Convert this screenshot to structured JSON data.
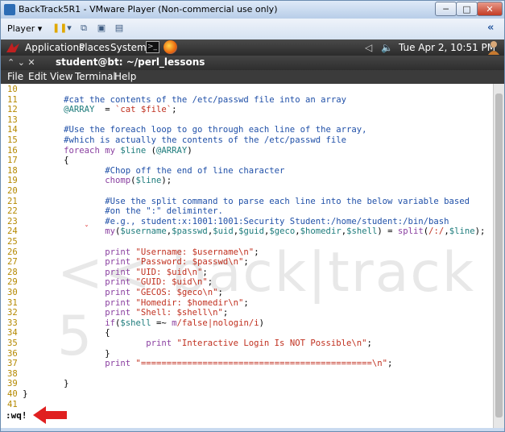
{
  "window": {
    "title": "BackTrack5R1 - VMware Player (Non-commercial use only)",
    "min_glyph": "─",
    "max_glyph": "□",
    "close_glyph": "✕"
  },
  "vmtoolbar": {
    "player_label": "Player ▾",
    "collapse_glyph": "«"
  },
  "gnome_panel": {
    "applications": "Applications",
    "places": "Places",
    "system": "System",
    "datetime": "Tue Apr  2, 10:51 PM"
  },
  "terminal": {
    "title": "student@bt: ~/perl_lessons",
    "controls": "⌃  ⌄  ✕",
    "menu": [
      "File",
      "Edit",
      "View",
      "Terminal",
      "Help"
    ]
  },
  "watermark": "<< back|track 5",
  "code_lines": [
    {
      "n": "10",
      "text": ""
    },
    {
      "n": "11",
      "text": "        #cat the contents of the /etc/passwd file into an array"
    },
    {
      "n": "12",
      "text": "        @ARRAY  = `cat $file`;"
    },
    {
      "n": "13",
      "text": ""
    },
    {
      "n": "14",
      "text": "        #Use the foreach loop to go through each line of the array,"
    },
    {
      "n": "15",
      "text": "        #which is actually the contents of the /etc/passwd file"
    },
    {
      "n": "16",
      "text": "        foreach my $line (@ARRAY)"
    },
    {
      "n": "17",
      "text": "        {"
    },
    {
      "n": "18",
      "text": "                #Chop off the end of line character"
    },
    {
      "n": "19",
      "text": "                chomp($line);"
    },
    {
      "n": "20",
      "text": ""
    },
    {
      "n": "21",
      "text": "                #Use the split command to parse each line into the below variable based"
    },
    {
      "n": "22",
      "text": "                #on the \":\" deliminter."
    },
    {
      "n": "23",
      "text": "                #e.g., student:x:1001:1001:Security Student:/home/student:/bin/bash"
    },
    {
      "n": "24",
      "text": "                my($username,$passwd,$uid,$guid,$geco,$homedir,$shell) = split(/:/,$line);"
    },
    {
      "n": "25",
      "text": ""
    },
    {
      "n": "26",
      "text": "                print \"Username: $username\\n\";"
    },
    {
      "n": "27",
      "text": "                print \"Password: $passwd\\n\";"
    },
    {
      "n": "28",
      "text": "                print \"UID: $uid\\n\";"
    },
    {
      "n": "29",
      "text": "                print \"GUID: $uid\\n\";"
    },
    {
      "n": "30",
      "text": "                print \"GECOS: $geco\\n\";"
    },
    {
      "n": "31",
      "text": "                print \"Homedir: $homedir\\n\";"
    },
    {
      "n": "32",
      "text": "                print \"Shell: $shell\\n\";"
    },
    {
      "n": "33",
      "text": "                if($shell =~ m/false|nologin/i)"
    },
    {
      "n": "34",
      "text": "                {"
    },
    {
      "n": "35",
      "text": "                        print \"Interactive Login Is NOT Possible\\n\";"
    },
    {
      "n": "36",
      "text": "                }"
    },
    {
      "n": "37",
      "text": "                print \"=============================================\\n\";"
    },
    {
      "n": "38",
      "text": ""
    },
    {
      "n": "39",
      "text": "        }"
    },
    {
      "n": "40",
      "text": "}"
    },
    {
      "n": "41",
      "text": ""
    }
  ],
  "command_line": ":wq!",
  "colors": {
    "line_number": "#b58900",
    "comment": "#2050a8",
    "keyword": "#8a3fa0",
    "string": "#c0301f",
    "variable": "#1e7c7c",
    "arrow": "#e02020"
  }
}
